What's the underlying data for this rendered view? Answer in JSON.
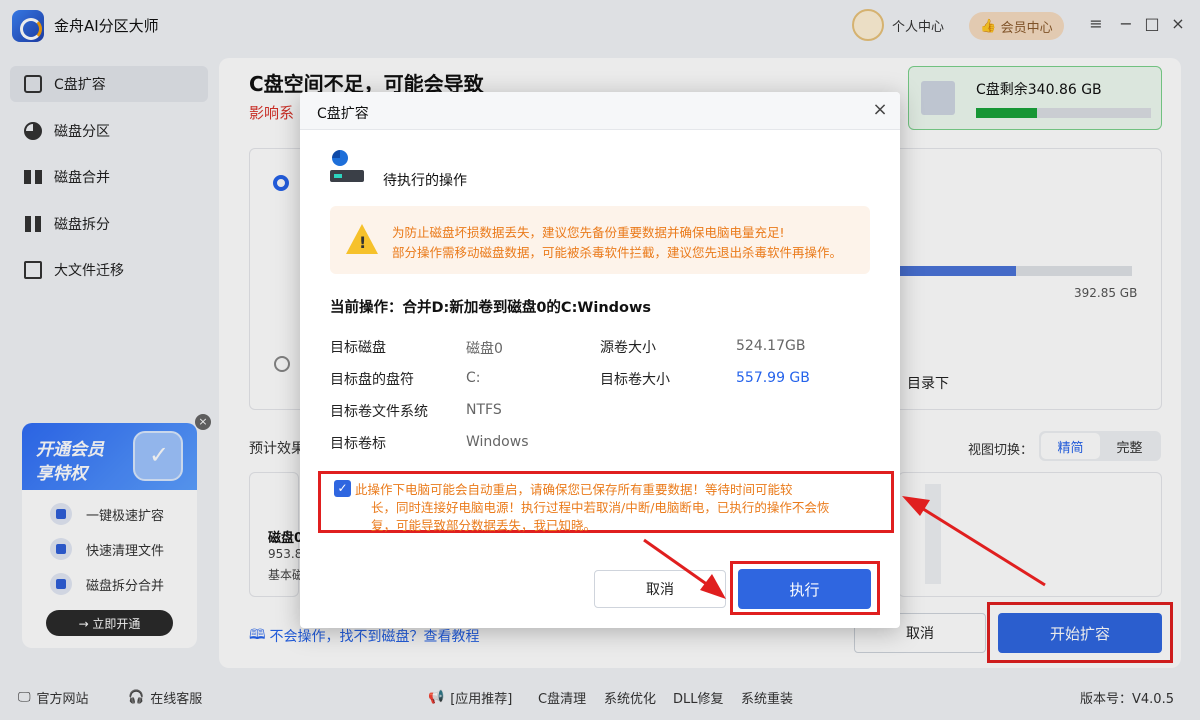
{
  "app": {
    "title": "金舟AI分区大师",
    "user_center": "个人中心",
    "vip_center": "会员中心"
  },
  "sidebar": {
    "items": [
      {
        "label": "C盘扩容"
      },
      {
        "label": "磁盘分区"
      },
      {
        "label": "磁盘合并"
      },
      {
        "label": "磁盘拆分"
      },
      {
        "label": "大文件迁移"
      }
    ]
  },
  "promo": {
    "title_line1": "开通会员",
    "title_line2": "享特权",
    "items": [
      "一键极速扩容",
      "快速清理文件",
      "磁盘拆分合并"
    ],
    "button": "→ 立即开通"
  },
  "main": {
    "title": "C盘空间不足，可能会导致",
    "subtitle": "影响系",
    "disk_card": {
      "label": "C盘剩余340.86 GB",
      "used_fraction": 0.35
    },
    "bg_bar_fraction": 0.5,
    "bg_size": "392.85 GB",
    "bg_dir": "目录下",
    "effect_label": "预计效果",
    "view_label": "视图切换：",
    "view_options": [
      "精简",
      "完整"
    ],
    "mini_card": {
      "name": "磁盘0",
      "size": "953.8",
      "type": "基本磁"
    },
    "help_link": "不会操作，找不到磁盘？查看教程",
    "cancel": "取消",
    "start": "开始扩容"
  },
  "dialog": {
    "title": "C盘扩容",
    "op_title": "待执行的操作",
    "warning_lines": [
      "为防止磁盘坏损数据丢失，建议您先备份重要数据并确保电脑电量充足!",
      "部分操作需移动磁盘数据，可能被杀毒软件拦截，建议您先退出杀毒软件再操作。"
    ],
    "current_op": "当前操作：合并D:新加卷到磁盘0的C:Windows",
    "fields_left": [
      {
        "k": "目标磁盘",
        "v": "磁盘0"
      },
      {
        "k": "目标盘的盘符",
        "v": "C:"
      },
      {
        "k": "目标卷文件系统",
        "v": "NTFS"
      },
      {
        "k": "目标卷标",
        "v": "Windows"
      }
    ],
    "fields_right": [
      {
        "k": "源卷大小",
        "v": "524.17GB"
      },
      {
        "k": "目标卷大小",
        "v": "557.99 GB"
      }
    ],
    "confirm_lines": [
      "此操作下电脑可能会自动重启，请确保您已保存所有重要数据！等待时间可能较",
      "长，同时连接好电脑电源！执行过程中若取消/中断/电脑断电，已执行的操作不会恢",
      "复，可能导致部分数据丢失，我已知晓。"
    ],
    "confirm_checked": true,
    "cancel": "取消",
    "execute": "执行"
  },
  "status": {
    "website": "官方网站",
    "service": "在线客服",
    "recommend": "[应用推荐]",
    "links": [
      "C盘清理",
      "系统优化",
      "DLL修复",
      "系统重装"
    ],
    "version": "版本号：V4.0.5"
  }
}
